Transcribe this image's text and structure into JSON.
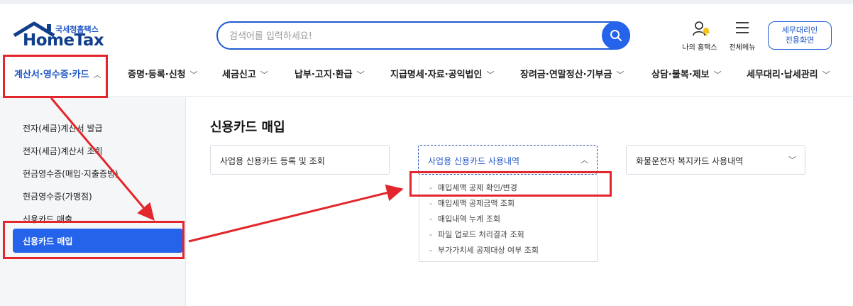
{
  "logo": {
    "korean": "국세청홈택스",
    "english": "HomeTax"
  },
  "search": {
    "placeholder": "검색어를 입력하세요!"
  },
  "utility": {
    "my_hometax": "나의 홈택스",
    "all_menu": "전체메뉴",
    "tax_agent_line1": "세무대리인",
    "tax_agent_line2": "전용화면"
  },
  "gnb": [
    {
      "label": "계산서·영수증·카드",
      "chevron": "up",
      "active": true
    },
    {
      "label": "증명·등록·신청",
      "chevron": "down"
    },
    {
      "label": "세금신고",
      "chevron": "down"
    },
    {
      "label": "납부·고지·환급",
      "chevron": "down"
    },
    {
      "label": "지급명세·자료·공익법인",
      "chevron": "down"
    },
    {
      "label": "장려금·연말정산·기부금",
      "chevron": "down"
    },
    {
      "label": "상담·불복·제보",
      "chevron": "down"
    },
    {
      "label": "세무대리·납세관리",
      "chevron": "down"
    }
  ],
  "sidebar": {
    "items": [
      "전자(세금)계산서 발급",
      "전자(세금)계산서 조회",
      "현금영수증(매입·지출증빙)",
      "현금영수증(가맹점)",
      "신용카드 매출"
    ],
    "active": "신용카드 매입"
  },
  "main": {
    "title": "신용카드 매입",
    "dropdowns": [
      {
        "label": "사업용 신용카드 등록 및 조회"
      },
      {
        "label": "사업용 신용카드 사용내역",
        "open": true
      },
      {
        "label": "화물운전자 복지카드 사용내역"
      }
    ],
    "submenu": [
      "매입세액 공제 확인/변경",
      "매입세액 공제금액 조회",
      "매입내역 누계 조회",
      "파일 업로드 처리결과 조회",
      "부가가치세 공제대상 여부 조회"
    ]
  },
  "colors": {
    "accent": "#2563eb",
    "brand": "#113f8c",
    "highlight": "#e3262b"
  }
}
